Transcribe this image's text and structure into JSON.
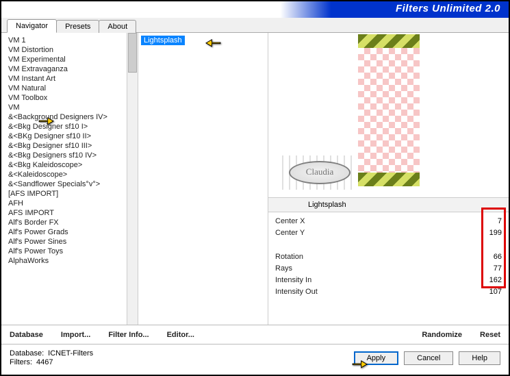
{
  "title": "Filters Unlimited 2.0",
  "tabs": [
    "Navigator",
    "Presets",
    "About"
  ],
  "col1_items": [
    "VM 1",
    "VM Distortion",
    "VM Experimental",
    "VM Extravaganza",
    "VM Instant Art",
    "VM Natural",
    "VM Toolbox",
    "VM",
    "&<Background Designers IV>",
    "&<Bkg Designer sf10 I>",
    "&<BKg Designer sf10 II>",
    "&<Bkg Designer sf10 III>",
    "&<Bkg Designers sf10 IV>",
    "&<Bkg Kaleidoscope>",
    "&<Kaleidoscope>",
    "&<Sandflower Specials°v°>",
    "[AFS IMPORT]",
    "AFH",
    "AFS IMPORT",
    "Alf's Border FX",
    "Alf's Power Grads",
    "Alf's Power Sines",
    "Alf's Power Toys",
    "AlphaWorks"
  ],
  "col2_selected": "Lightsplash",
  "preview_label": "Lightsplash",
  "params": [
    {
      "lbl": "Center X",
      "val": "7"
    },
    {
      "lbl": "Center Y",
      "val": "199"
    }
  ],
  "params2": [
    {
      "lbl": "Rotation",
      "val": "66"
    },
    {
      "lbl": "Rays",
      "val": "77"
    },
    {
      "lbl": "Intensity In",
      "val": "162"
    },
    {
      "lbl": "Intensity Out",
      "val": "107"
    }
  ],
  "row1": {
    "database": "Database",
    "import": "Import...",
    "filterinfo": "Filter Info...",
    "editor": "Editor...",
    "randomize": "Randomize",
    "reset": "Reset"
  },
  "status": {
    "db_lbl": "Database:",
    "db_val": "ICNET-Filters",
    "f_lbl": "Filters:",
    "f_val": "4467"
  },
  "buttons": {
    "apply": "Apply",
    "cancel": "Cancel",
    "help": "Help"
  },
  "watermark": "Claudia"
}
